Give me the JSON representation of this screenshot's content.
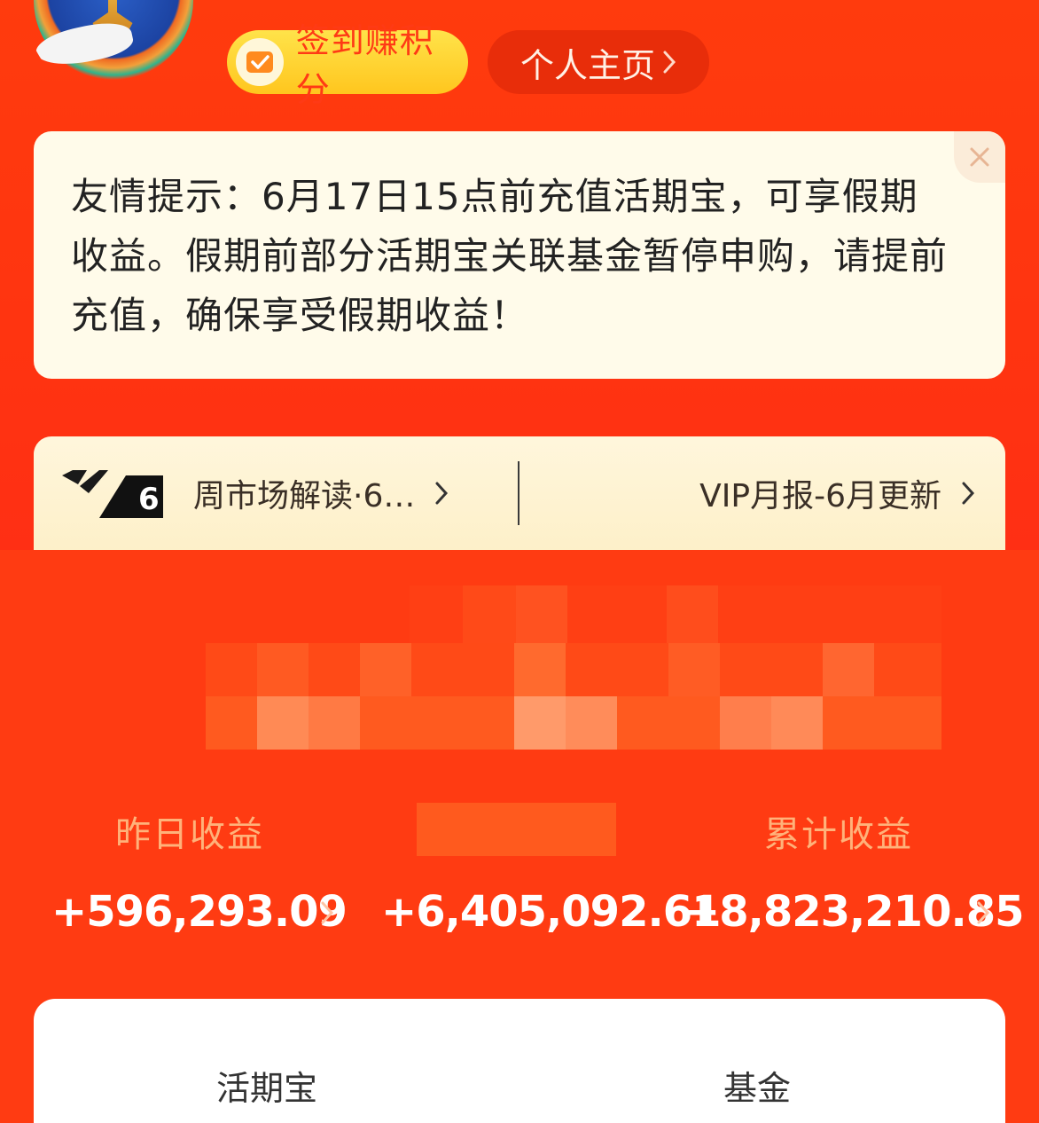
{
  "header": {
    "signin_label": "签到赚积分",
    "profile_label": "个人主页"
  },
  "notice": {
    "text": "友情提示：6月17日15点前充值活期宝，可享假期收益。假期前部分活期宝关联基金暂停申购，请提前充值，确保享受假期收益！"
  },
  "vip": {
    "logo_text": "6",
    "weekly_label": "周市场解读·6…",
    "monthly_label": "VIP月报-6月更新"
  },
  "earnings": {
    "yesterday_label": "昨日收益",
    "yesterday_value": "+596,293.09",
    "middle_value": "+6,405,092.61",
    "total_label": "累计收益",
    "total_value": "+8,823,210.85"
  },
  "tabs": {
    "left": "活期宝",
    "right": "基金"
  },
  "colors": {
    "background": "#ff3b12",
    "signin_bg": "#ffd633",
    "notice_bg": "#fffbea",
    "label_orange": "#ffb27a"
  }
}
